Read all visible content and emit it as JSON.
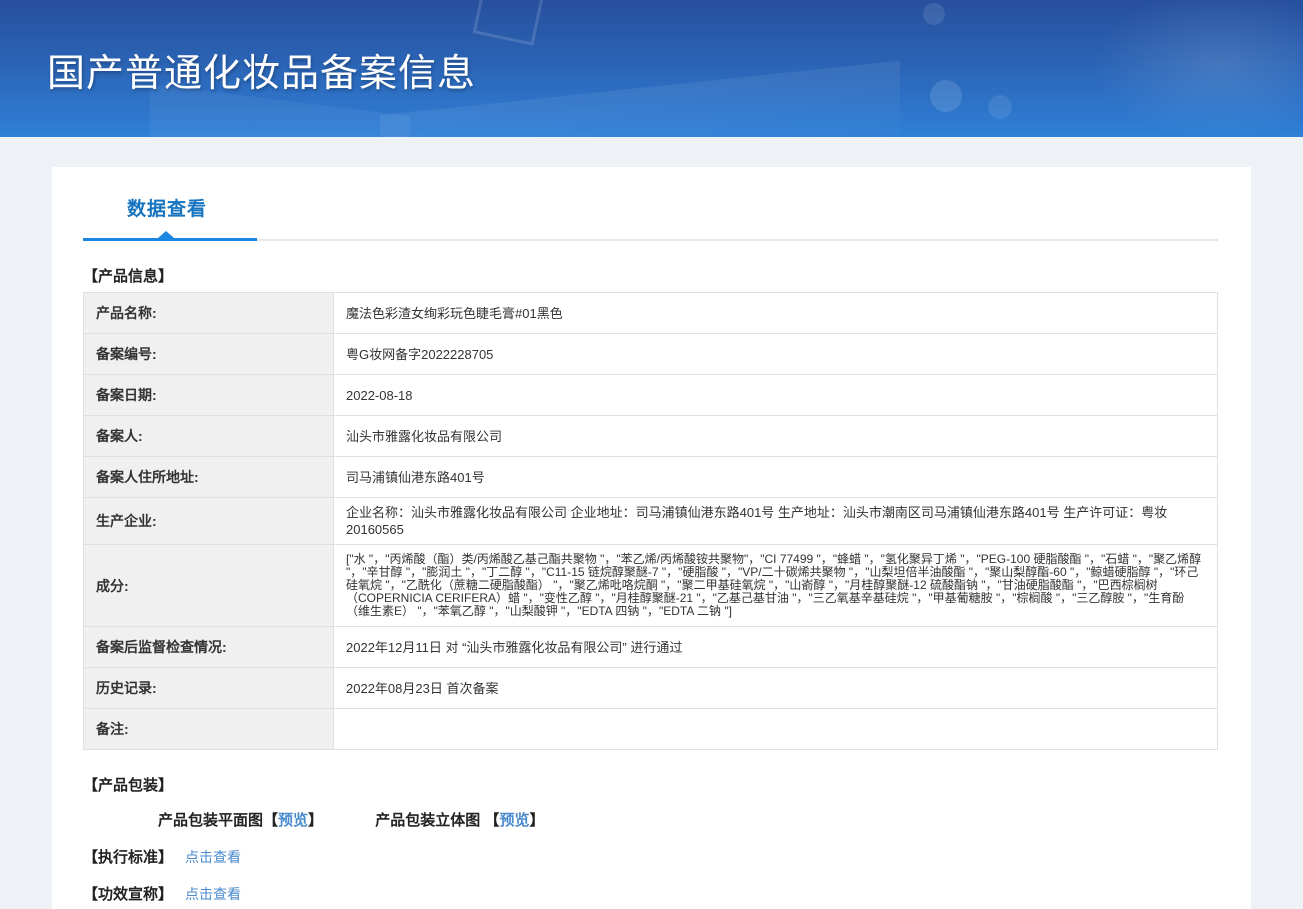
{
  "page": {
    "title": "国产普通化妆品备案信息"
  },
  "tab": {
    "label": "数据查看"
  },
  "product_info": {
    "section_title": "【产品信息】",
    "rows": [
      {
        "label": "产品名称:",
        "value": "魔法色彩渣女绚彩玩色睫毛膏#01黑色"
      },
      {
        "label": "备案编号:",
        "value": "粤G妆网备字2022228705"
      },
      {
        "label": "备案日期:",
        "value": "2022-08-18"
      },
      {
        "label": "备案人:",
        "value": "汕头市雅露化妆品有限公司"
      },
      {
        "label": "备案人住所地址:",
        "value": "司马浦镇仙港东路401号"
      },
      {
        "label": "生产企业:",
        "value": "企业名称：汕头市雅露化妆品有限公司 企业地址：司马浦镇仙港东路401号 生产地址：汕头市潮南区司马浦镇仙港东路401号 生产许可证：粤妆20160565"
      },
      {
        "label": "成分:",
        "value": "[\"水 \"，\"丙烯酸（酯）类/丙烯酸乙基己酯共聚物 \"，\"苯乙烯/丙烯酸铵共聚物\"，\"CI 77499 \"，\"蜂蜡 \"，\"氢化聚异丁烯 \"，\"PEG-100 硬脂酸酯 \"，\"石蜡 \"，\"聚乙烯醇 \"，\"辛甘醇 \"，\"膨润土 \"，\"丁二醇 \"，\"C11-15 链烷醇聚醚-7 \"，\"硬脂酸 \"，\"VP/二十碳烯共聚物 \"，\"山梨坦倍半油酸酯 \"，\"聚山梨醇酯-60 \"，\"鲸蜡硬脂醇 \"，\"环己硅氧烷 \"，\"乙酰化（蔗糖二硬脂酸酯） \"，\"聚乙烯吡咯烷酮 \"，\"聚二甲基硅氧烷 \"，\"山嵛醇 \"，\"月桂醇聚醚-12 硫酸酯钠 \"，\"甘油硬脂酸酯 \"，\"巴西棕榈树（COPERNICIA CERIFERA）蜡 \"，\"变性乙醇 \"，\"月桂醇聚醚-21 \"，\"乙基己基甘油 \"，\"三乙氧基辛基硅烷 \"，\"甲基葡糖胺 \"，\"棕榈酸 \"，\"三乙醇胺 \"，\"生育酚（维生素E） \"，\"苯氧乙醇 \"，\"山梨酸钾 \"，\"EDTA 四钠 \"，\"EDTA 二钠 \"]"
      },
      {
        "label": "备案后监督检查情况:",
        "value": "2022年12月11日 对 “汕头市雅露化妆品有限公司” 进行通过"
      },
      {
        "label": "历史记录:",
        "value": "2022年08月23日 首次备案"
      },
      {
        "label": "备注:",
        "value": ""
      }
    ]
  },
  "packaging": {
    "section_title": "【产品包装】",
    "flat_label": "产品包装平面图",
    "stereo_label": "产品包装立体图",
    "bracket_open": "【",
    "bracket_close": "】",
    "preview_label": "预览"
  },
  "standard": {
    "section_title": "【执行标准】",
    "link_label": "点击查看"
  },
  "efficacy": {
    "section_title": "【功效宣称】",
    "link_label": "点击查看"
  },
  "colors": {
    "header_gradient_top": "#27509e",
    "header_gradient_bottom": "#2f80d8",
    "tab_blue": "#1674c0",
    "underline_blue": "#1b87e3",
    "link_blue": "#4a8bcd",
    "page_background": "#eef1f5",
    "table_outer_border": "#a4c0e4",
    "label_cell_background": "#f0f0f0"
  }
}
